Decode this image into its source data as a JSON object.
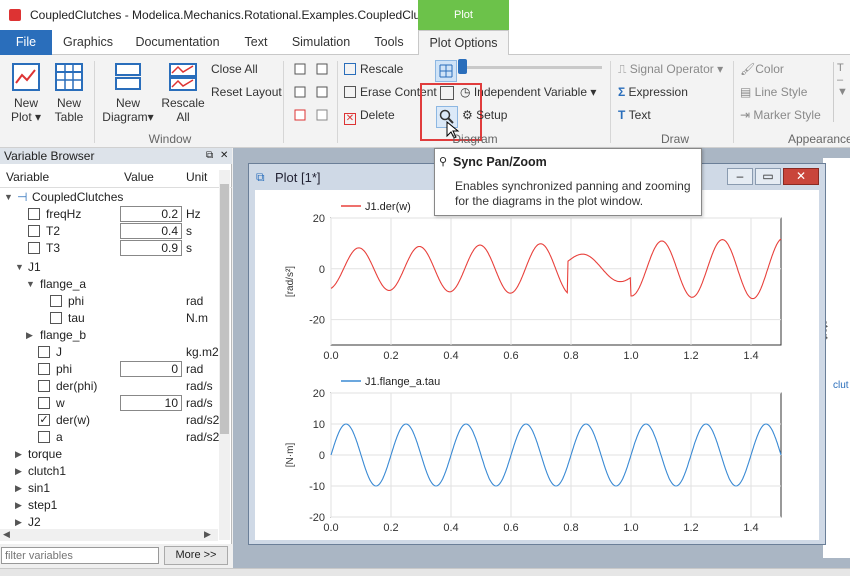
{
  "title": "CoupledClutches - Modelica.Mechanics.Rotational.Examples.CoupledClutches  (...",
  "context_tab": "Plot",
  "tabs": [
    "File",
    "Graphics",
    "Documentation",
    "Text",
    "Simulation",
    "Tools",
    "Plot Options"
  ],
  "ribbon": {
    "new_plot": "New",
    "new_plot2": "Plot",
    "new_table": "New",
    "new_table2": "Table",
    "new_diagram": "New",
    "new_diagram2": "Diagram",
    "rescale_all": "Rescale",
    "rescale_all2": "All",
    "close_all": "Close All",
    "reset_layout": "Reset Layout",
    "rescale": "Rescale",
    "erase_content": "Erase Content",
    "delete": "Delete",
    "independent_variable": "Independent Variable",
    "setup": "Setup",
    "signal_operator": "Signal Operator",
    "expression": "Expression",
    "text": "Text",
    "color": "Color",
    "line_style": "Line Style",
    "marker_style": "Marker Style",
    "groups": {
      "window": "Window",
      "diagram": "Diagram",
      "draw": "Draw",
      "appearance": "Appearance"
    }
  },
  "variable_browser": {
    "header": "Variable Browser",
    "columns": {
      "variable": "Variable",
      "value": "Value",
      "unit": "Unit"
    },
    "filter_placeholder": "filter variables",
    "more_button": "More >>",
    "rows": [
      {
        "label": "CoupledClutches",
        "value": "",
        "unit": ""
      },
      {
        "label": "freqHz",
        "value": "0.2",
        "unit": "Hz"
      },
      {
        "label": "T2",
        "value": "0.4",
        "unit": "s"
      },
      {
        "label": "T3",
        "value": "0.9",
        "unit": "s"
      },
      {
        "label": "J1",
        "value": "",
        "unit": ""
      },
      {
        "label": "flange_a",
        "value": "",
        "unit": ""
      },
      {
        "label": "phi",
        "value": "",
        "unit": "rad"
      },
      {
        "label": "tau",
        "value": "",
        "unit": "N.m"
      },
      {
        "label": "flange_b",
        "value": "",
        "unit": ""
      },
      {
        "label": "J",
        "value": "",
        "unit": "kg.m2"
      },
      {
        "label": "phi",
        "value": "0",
        "unit": "rad"
      },
      {
        "label": "der(phi)",
        "value": "",
        "unit": "rad/s"
      },
      {
        "label": "w",
        "value": "10",
        "unit": "rad/s"
      },
      {
        "label": "der(w)",
        "value": "",
        "unit": "rad/s2"
      },
      {
        "label": "a",
        "value": "",
        "unit": "rad/s2"
      },
      {
        "label": "torque",
        "value": "",
        "unit": ""
      },
      {
        "label": "clutch1",
        "value": "",
        "unit": ""
      },
      {
        "label": "sin1",
        "value": "",
        "unit": ""
      },
      {
        "label": "step1",
        "value": "",
        "unit": ""
      },
      {
        "label": "J2",
        "value": "",
        "unit": ""
      }
    ]
  },
  "plot_window": {
    "title": "Plot [1*]"
  },
  "tooltip": {
    "title": "Sync Pan/Zoom",
    "body": "Enables synchronized panning and zooming for the diagrams in the plot window."
  },
  "side_labels": {
    "start": "start",
    "clutch": "clut"
  },
  "chart_data": [
    {
      "type": "line",
      "series": [
        {
          "name": "J1.der(w)",
          "color": "#e8413c"
        }
      ],
      "ylabel": "[rad/s²]",
      "xlim": [
        0,
        1.5
      ],
      "ylim": [
        -30,
        20
      ],
      "xticks": [
        "0.0",
        "0.2",
        "0.4",
        "0.6",
        "0.8",
        "1.0",
        "1.2",
        "1.4"
      ],
      "yticks": [
        "20",
        "0",
        "-20"
      ],
      "grid": true,
      "legend": "top-left"
    },
    {
      "type": "line",
      "series": [
        {
          "name": "J1.flange_a.tau",
          "color": "#3a8ad4"
        }
      ],
      "ylabel": "[N·m]",
      "xlim": [
        0,
        1.5
      ],
      "ylim": [
        -20,
        20
      ],
      "xticks": [
        "0.0",
        "0.2",
        "0.4",
        "0.6",
        "0.8",
        "1.0",
        "1.2",
        "1.4"
      ],
      "yticks": [
        "20",
        "10",
        "0",
        "-10",
        "-20"
      ],
      "grid": true,
      "legend": "top-left"
    }
  ]
}
